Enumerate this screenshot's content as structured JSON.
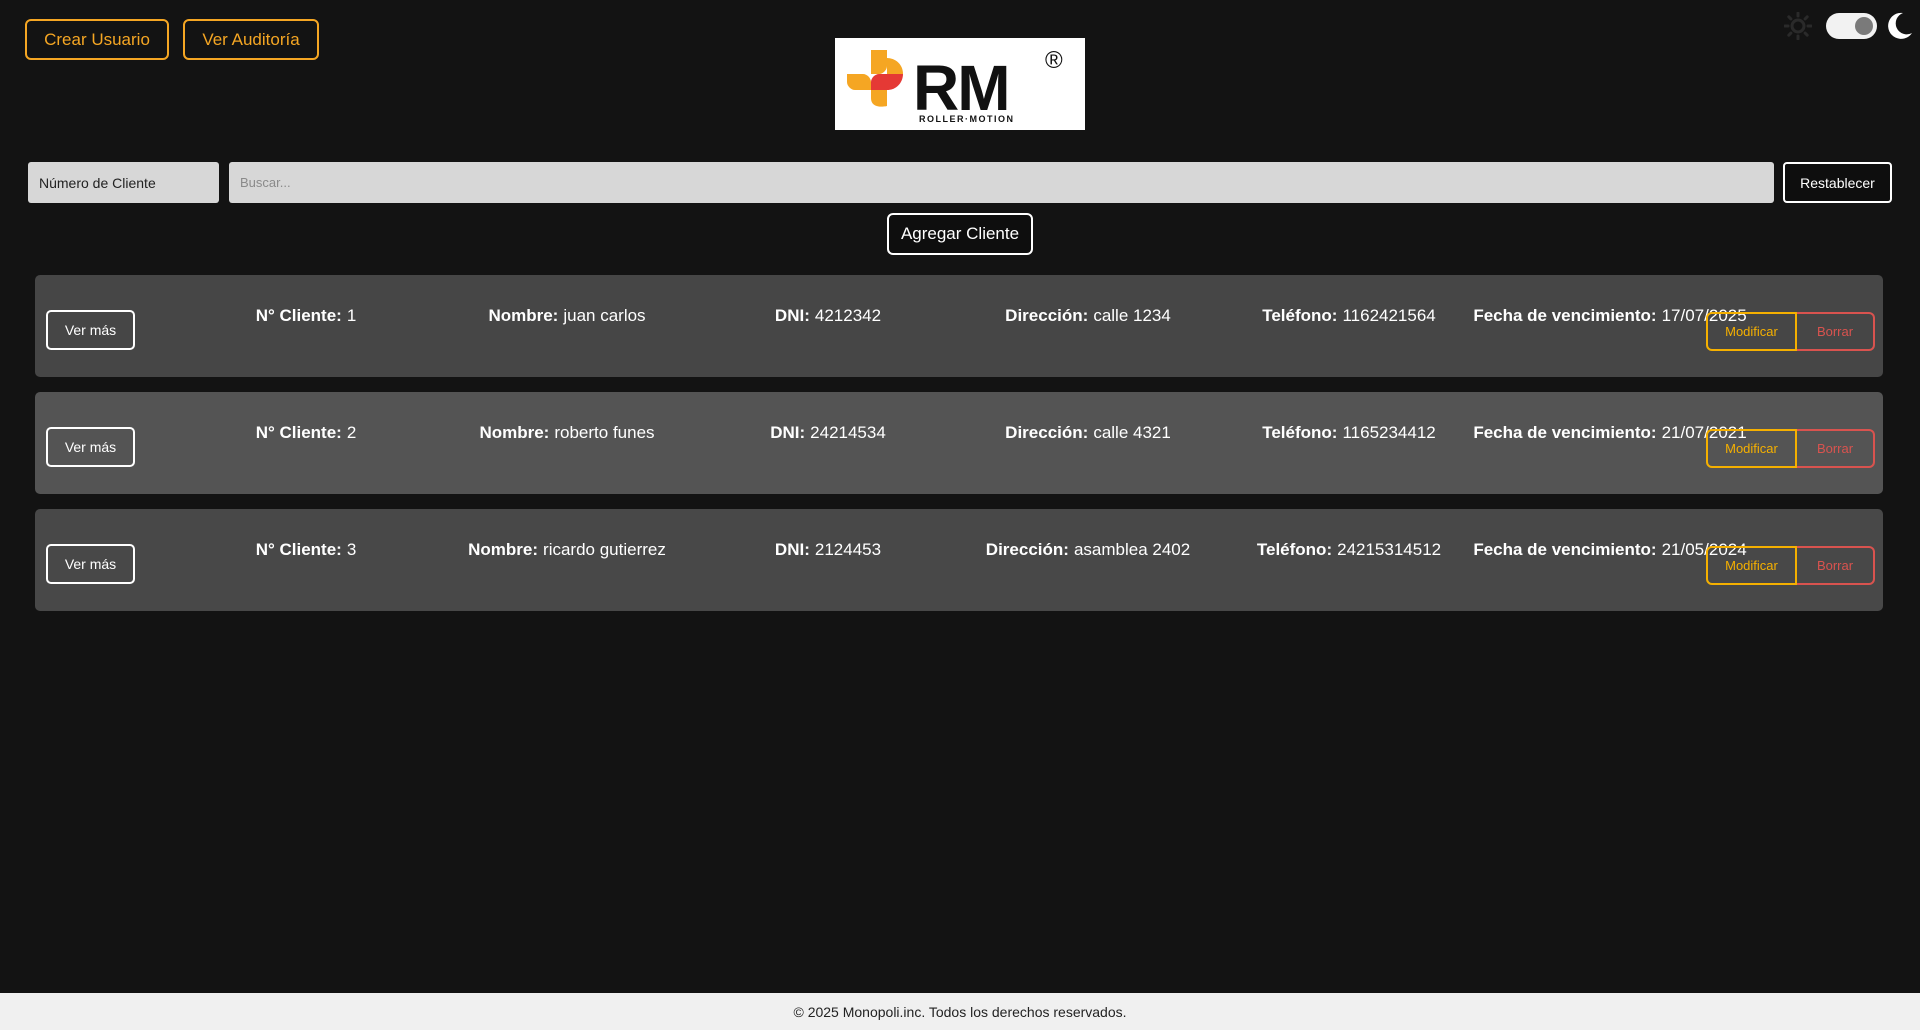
{
  "header": {
    "create_user_label": "Crear Usuario",
    "audit_label": "Ver Auditoría"
  },
  "logo": {
    "brand": "RM",
    "tagline": "ROLLER·MOTION",
    "registered": "®"
  },
  "search": {
    "filter_selected": "Número de Cliente",
    "placeholder": "Buscar...",
    "reset_label": "Restablecer",
    "add_label": "Agregar Cliente"
  },
  "labels": {
    "view_more": "Ver más",
    "client_no": "N° Cliente:",
    "name": "Nombre:",
    "dni": "DNI:",
    "address": "Dirección:",
    "phone": "Teléfono:",
    "expiry": "Fecha de vencimiento:",
    "modify": "Modificar",
    "delete": "Borrar"
  },
  "clients": [
    {
      "id": "1",
      "name": "juan carlos",
      "dni": "4212342",
      "address": "calle 1234",
      "phone": "1162421564",
      "expiry": "17/07/2025"
    },
    {
      "id": "2",
      "name": "roberto funes",
      "dni": "24214534",
      "address": "calle 4321",
      "phone": "1165234412",
      "expiry": "21/07/2021"
    },
    {
      "id": "3",
      "name": "ricardo gutierrez",
      "dni": "2124453",
      "address": "asamblea 2402",
      "phone": "24215314512",
      "expiry": "21/05/2024"
    }
  ],
  "footer": {
    "copyright": "© 2025 Monopoli.inc. Todos los derechos reservados."
  },
  "colors": {
    "background": "#131313",
    "accent": "#f5a623",
    "danger": "#d9534f",
    "card_1": "#464646",
    "card_2": "#545454",
    "card_3": "#484848"
  },
  "icons": {
    "theme_light": "sun-icon",
    "theme_dark": "moon-icon"
  }
}
